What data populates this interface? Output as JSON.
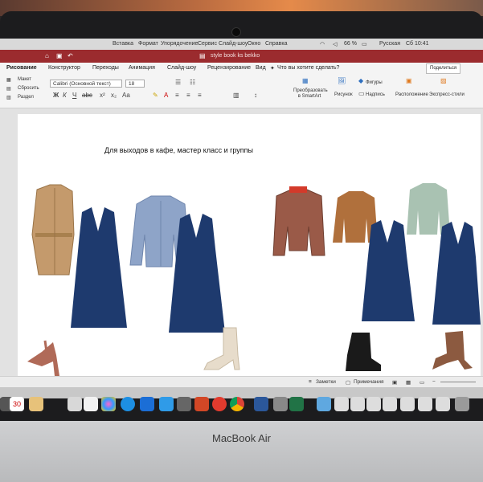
{
  "menubar": {
    "items": [
      "Вставка",
      "Формат",
      "Упорядочение",
      "Сервис",
      "Слайд-шоу",
      "Окно",
      "Справка"
    ],
    "battery": "66 %",
    "language": "Русская",
    "clock": "Сб 10:41"
  },
  "window": {
    "title": "style book ks bekko"
  },
  "ribbon_tabs": [
    "Рисование",
    "Конструктор",
    "Переходы",
    "Анимация",
    "Слайд-шоу",
    "Рецензирование",
    "Вид"
  ],
  "tell_me": "Что вы хотите сделать?",
  "share_label": "Поделиться",
  "ribbon": {
    "layout_label": "Макет",
    "reset_label": "Сбросить",
    "section_label": "Раздел",
    "font_name": "Calibri (Основной текст)",
    "font_size": "18",
    "smartart_label": "Преобразовать в SmartArt",
    "picture_label": "Рисунок",
    "shapes_label": "Фигуры",
    "textbox_label": "Надпись",
    "arrange_label": "Расположение",
    "quick_styles_label": "Экспресс-стили"
  },
  "slide": {
    "title": "Для выходов в кафе, мастер класс и группы"
  },
  "statusbar": {
    "notes_label": "Заметки",
    "comments_label": "Примечания"
  },
  "dock": {
    "calendar_day": "30"
  },
  "laptop": {
    "brand": "MacBook Air"
  },
  "colors": {
    "titlebar": "#9b2b2e",
    "denim_dress": "#1e3a6e",
    "trench_coat": "#c49a6c",
    "cardigan": "#8ea4c8",
    "plaid_jacket": "#9a5a48",
    "sweater_brown": "#b0703c",
    "sweater_mint": "#a9c2b2"
  }
}
